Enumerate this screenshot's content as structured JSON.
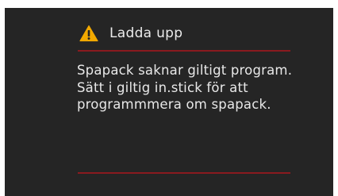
{
  "dialog": {
    "title": "Ladda upp",
    "icon": "warning-icon",
    "message": "Spapack saknar giltigt program. Sätt i giltig in.stick för att programmmera om spapack."
  },
  "colors": {
    "background": "#252525",
    "divider": "#8a1a1f",
    "warning": "#f2a900",
    "text": "#e8e8e8"
  }
}
